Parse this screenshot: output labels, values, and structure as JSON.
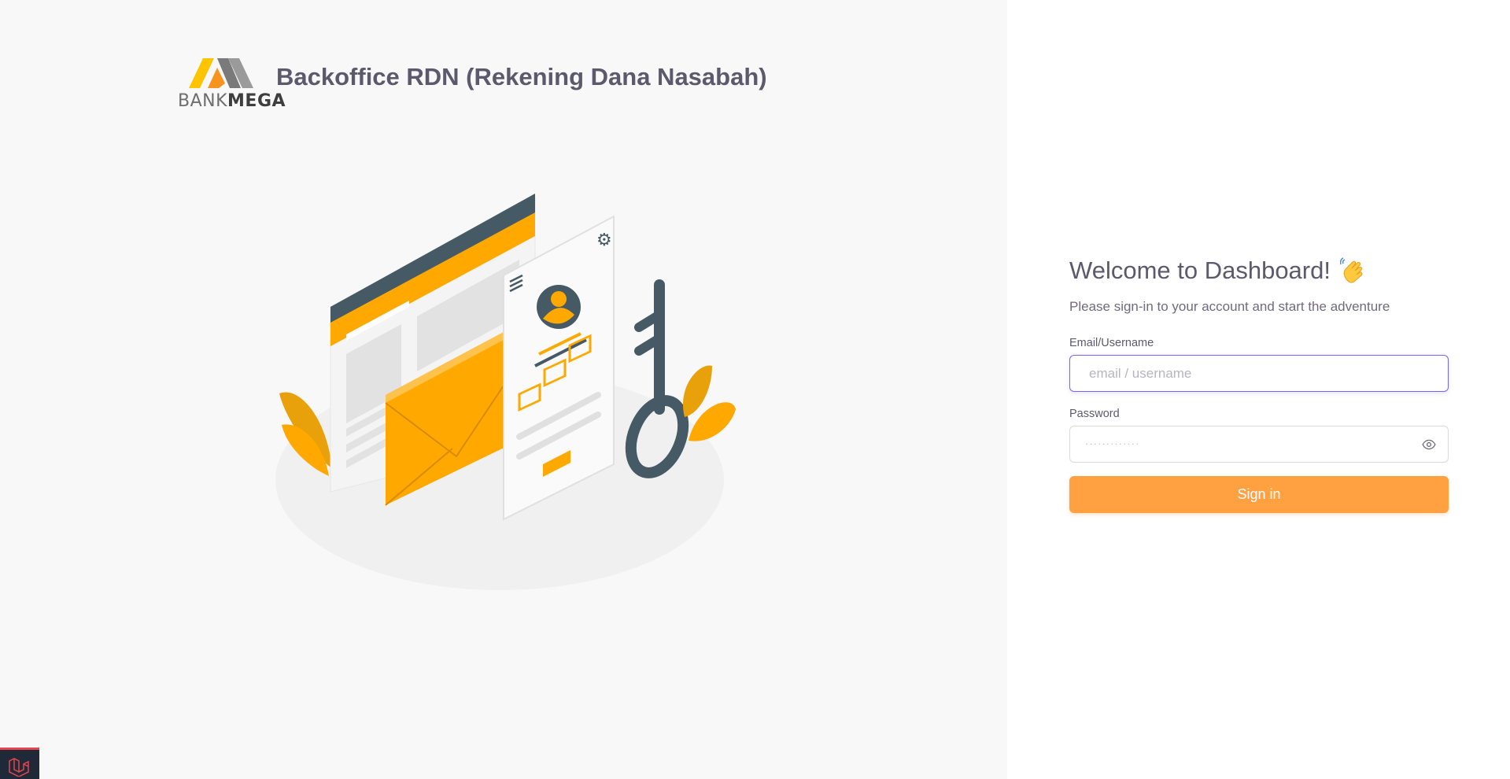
{
  "brand": {
    "logo_text_light": "BANK",
    "logo_text_bold": "MEGA",
    "app_title": "Backoffice RDN (Rekening Dana Nasabah)"
  },
  "login": {
    "heading": "Welcome to Dashboard!",
    "heading_icon": "waving-hand-icon",
    "subtitle": "Please sign-in to your account and start the adventure",
    "email_label": "Email/Username",
    "email_placeholder": "email / username",
    "email_value": "",
    "password_label": "Password",
    "password_mask": "·············",
    "password_toggle_icon": "eye-icon",
    "signin_label": "Sign in"
  },
  "colors": {
    "accent": "#ffa041",
    "focus": "#7367f0",
    "text_heading": "#5d596c",
    "left_bg": "#f8f8f8",
    "illustration_orange": "#ffa800",
    "illustration_dark": "#455a64"
  },
  "debug_badge": {
    "icon": "laravel-icon"
  }
}
